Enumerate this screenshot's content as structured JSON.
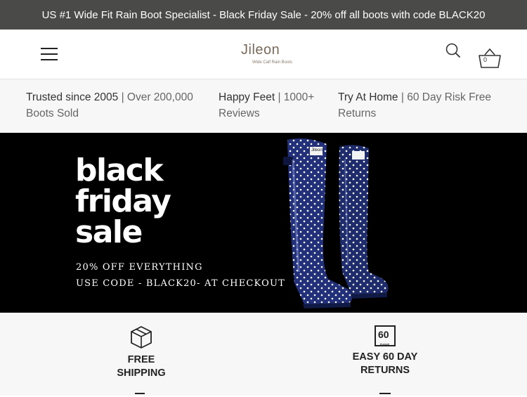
{
  "announcement": "US #1 Wide Fit Rain Boot Specialist - Black Friday Sale - 20% off all boots with code BLACK20",
  "header": {
    "logo_text": "Jileon",
    "logo_subtext": "Wide Calf Rain Boots",
    "cart_count": "0",
    "menu_icon": "hamburger-menu-icon",
    "search_icon": "search-icon",
    "cart_icon": "basket-icon"
  },
  "trust": [
    {
      "title": "Trusted since 2005",
      "text": " | Over 200,000 Boots Sold"
    },
    {
      "title": "Happy Feet",
      "text": " | 1000+ Reviews"
    },
    {
      "title": "Try At Home",
      "text": " | 60 Day Risk Free Returns"
    }
  ],
  "hero": {
    "line1": "black",
    "line2": "friday",
    "line3": "sale",
    "offer": "20% OFF EVERYTHING",
    "code_text": "USE CODE - BLACK20- AT CHECKOUT",
    "boot_label": "Jileon"
  },
  "features": [
    {
      "line1": "FREE",
      "line2": "SHIPPING",
      "icon": "box-icon"
    },
    {
      "line1": "EASY 60 DAY",
      "line2": "RETURNS",
      "icon": "60-days-icon",
      "icon_text": "60",
      "icon_subtext": "DAYS"
    }
  ],
  "colors": {
    "announcement_bg": "#4a4a48",
    "hero_bg": "#000000",
    "boot_blue": "#1e2c6b",
    "trust_bg": "#f7f7f7"
  }
}
